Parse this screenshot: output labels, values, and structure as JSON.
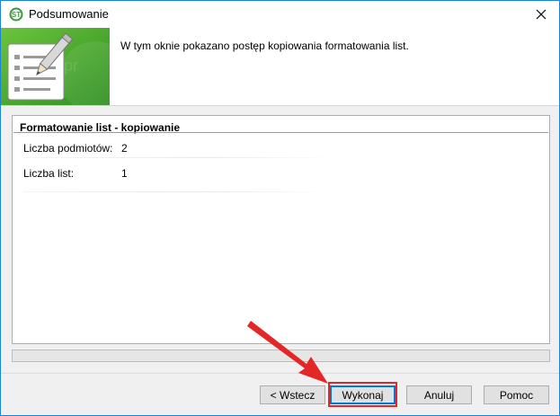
{
  "window": {
    "title": "Podsumowanie"
  },
  "header": {
    "description": "W tym oknie pokazano postęp kopiowania formatowania list.",
    "watermark": "programetr"
  },
  "panel": {
    "title": "Formatowanie list - kopiowanie",
    "fields": [
      {
        "label": "Liczba podmiotów:",
        "value": "2"
      },
      {
        "label": "Liczba list:",
        "value": "1"
      }
    ]
  },
  "progress": {
    "value": 0
  },
  "buttons": {
    "back": "< Wstecz",
    "execute": "Wykonaj",
    "cancel": "Anuluj",
    "help": "Pomoc"
  },
  "annotation": {
    "highlight_color": "#e32626",
    "arrow_color": "#e32626",
    "target": "execute-button"
  },
  "colors": {
    "banner_green": "#4aa832",
    "window_border": "#1883d7"
  }
}
